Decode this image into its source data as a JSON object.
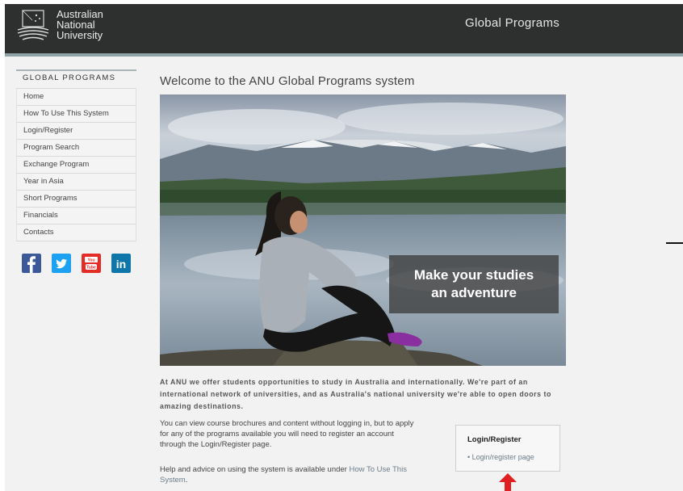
{
  "header": {
    "logo_lines": [
      "Australian",
      "National",
      "University"
    ],
    "site_title": "Global Programs"
  },
  "sidebar": {
    "heading": "GLOBAL PROGRAMS",
    "items": [
      {
        "label": "Home"
      },
      {
        "label": "How To Use This System"
      },
      {
        "label": "Login/Register"
      },
      {
        "label": "Program Search"
      },
      {
        "label": "Exchange Program"
      },
      {
        "label": "Year in Asia"
      },
      {
        "label": "Short Programs"
      },
      {
        "label": "Financials"
      },
      {
        "label": "Contacts"
      }
    ],
    "social": [
      {
        "icon": "facebook-icon",
        "glyph": "f",
        "color": "#3b5998"
      },
      {
        "icon": "twitter-icon",
        "glyph": "t",
        "color": "#1da1f2"
      },
      {
        "icon": "youtube-icon",
        "glyph": "You Tube",
        "color": "#e52d27"
      },
      {
        "icon": "linkedin-icon",
        "glyph": "in",
        "color": "#0e76a8"
      }
    ]
  },
  "main": {
    "welcome_title": "Welcome to the ANU Global Programs system",
    "hero_tagline_1": "Make your studies",
    "hero_tagline_2": "an adventure",
    "intro": "At ANU we offer students opportunities to study in Australia and internationally. We're part of an international network of universities, and as Australia's national university we're able to open doors to amazing destinations.",
    "para1_line1": "You can view course brochures and content without logging in, but to apply",
    "para1_line2": "for any of the programs available you will need to register an account",
    "para1_line3": "through the Login/Register page.",
    "para2_prefix": "Help and advice on using the system is available under",
    "para2_link": "How To Use This",
    "para2_link2": "System",
    "para2_suffix": "."
  },
  "login_box": {
    "title": "Login/Register",
    "link": "Login/register page"
  },
  "colors": {
    "header_bg": "#2e2f2f",
    "accent_bar": "#8fa3a6",
    "arrow": "#e02020"
  }
}
